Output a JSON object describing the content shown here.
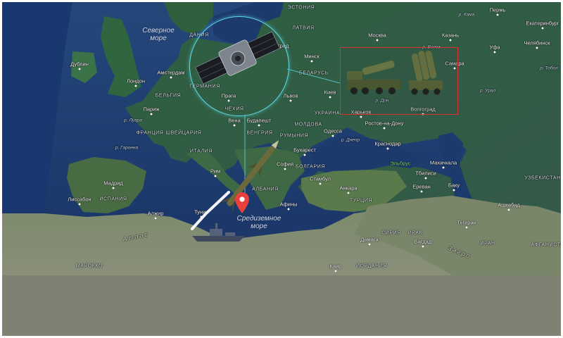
{
  "map": {
    "cities": [
      {
        "id": "dublin",
        "name": "Дублин"
      },
      {
        "id": "london",
        "name": "Лондон"
      },
      {
        "id": "amsterdam",
        "name": "Амстердам"
      },
      {
        "id": "paris",
        "name": "Париж"
      },
      {
        "id": "prague",
        "name": "Прага"
      },
      {
        "id": "vienna",
        "name": "Вена"
      },
      {
        "id": "budapest",
        "name": "Будапешт"
      },
      {
        "id": "madrid",
        "name": "Мадрид"
      },
      {
        "id": "lisbon",
        "name": "Лиссабон"
      },
      {
        "id": "rome",
        "name": "Рим"
      },
      {
        "id": "algiers",
        "name": "Алжир"
      },
      {
        "id": "tunis",
        "name": "Тунис"
      },
      {
        "id": "athens",
        "name": "Афины"
      },
      {
        "id": "sofia",
        "name": "София"
      },
      {
        "id": "bucharest",
        "name": "Бухарест"
      },
      {
        "id": "istanbul",
        "name": "Стамбул"
      },
      {
        "id": "ankara",
        "name": "Анкара"
      },
      {
        "id": "odessa",
        "name": "Одесса"
      },
      {
        "id": "kiev",
        "name": "Киев"
      },
      {
        "id": "lviv",
        "name": "Львов"
      },
      {
        "id": "minsk",
        "name": "Минск"
      },
      {
        "id": "kaliningrad",
        "name": "Калининград"
      },
      {
        "id": "moscow",
        "name": "Москва"
      },
      {
        "id": "kazan",
        "name": "Казань"
      },
      {
        "id": "samara",
        "name": "Самара"
      },
      {
        "id": "ufa",
        "name": "Уфа"
      },
      {
        "id": "perm",
        "name": "Пермь"
      },
      {
        "id": "yekaterinburg",
        "name": "Екатеринбург"
      },
      {
        "id": "chelyabinsk",
        "name": "Челябинск"
      },
      {
        "id": "kharkov",
        "name": "Харьков"
      },
      {
        "id": "volgograd",
        "name": "Волгоград"
      },
      {
        "id": "rostov",
        "name": "Ростов-на-Дону"
      },
      {
        "id": "krasnodar",
        "name": "Краснодар"
      },
      {
        "id": "tbilisi",
        "name": "Тбилиси"
      },
      {
        "id": "yerevan",
        "name": "Ереван"
      },
      {
        "id": "baku",
        "name": "Баку"
      },
      {
        "id": "makhachkala",
        "name": "Махачкала"
      },
      {
        "id": "ashgabat",
        "name": "Ашхабад"
      },
      {
        "id": "tehran",
        "name": "Тегеран"
      },
      {
        "id": "damascus",
        "name": "Дамаск"
      },
      {
        "id": "baghdad",
        "name": "Багдад"
      },
      {
        "id": "cairo",
        "name": "Каир"
      }
    ],
    "countries": [
      {
        "id": "estonia",
        "name": "ЭСТОНИЯ"
      },
      {
        "id": "latvia",
        "name": "ЛАТВИЯ"
      },
      {
        "id": "denmark",
        "name": "ДАНИЯ"
      },
      {
        "id": "belarus",
        "name": "БЕЛАРУСЬ"
      },
      {
        "id": "germany",
        "name": "ГЕРМАНИЯ"
      },
      {
        "id": "belgium",
        "name": "БЕЛЬГИЯ"
      },
      {
        "id": "czech",
        "name": "ЧЕХИЯ"
      },
      {
        "id": "ukraine",
        "name": "УКРАИНА"
      },
      {
        "id": "moldova",
        "name": "МОЛДОВА"
      },
      {
        "id": "hungary",
        "name": "ВЕНГРИЯ"
      },
      {
        "id": "romania",
        "name": "РУМЫНИЯ"
      },
      {
        "id": "switzerland",
        "name": "ШВЕЙЦАРИЯ"
      },
      {
        "id": "france",
        "name": "ФРАНЦИЯ"
      },
      {
        "id": "italy",
        "name": "ИТАЛИЯ"
      },
      {
        "id": "spain",
        "name": "ИСПАНИЯ"
      },
      {
        "id": "bulgaria",
        "name": "БОЛГАРИЯ"
      },
      {
        "id": "albania",
        "name": "АЛБАНИЯ"
      },
      {
        "id": "turkey",
        "name": "ТУРЦИЯ"
      },
      {
        "id": "syria",
        "name": "СИРИЯ"
      },
      {
        "id": "iraq",
        "name": "ИРАК"
      },
      {
        "id": "iran",
        "name": "ИРАН"
      },
      {
        "id": "uzbekistan",
        "name": "УЗБЕКИСТАН"
      },
      {
        "id": "afghanistan",
        "name": "АФГАНИСТАН"
      },
      {
        "id": "morocco",
        "name": "МАРОККО"
      },
      {
        "id": "jordan",
        "name": "ИОРДАНИЯ"
      }
    ],
    "seas": [
      {
        "id": "north-sea",
        "name": "Северное\nморе"
      },
      {
        "id": "mediterranean",
        "name": "Средиземное\nморе"
      }
    ],
    "mountains": [
      {
        "id": "atlas",
        "name": "Атлас"
      },
      {
        "id": "zagros",
        "name": "Загро"
      }
    ],
    "rivers": [
      {
        "id": "r-ural",
        "name": "р. Урал"
      },
      {
        "id": "r-volga",
        "name": "р. Волга"
      },
      {
        "id": "r-don",
        "name": "р. Дон"
      },
      {
        "id": "r-kama",
        "name": "р. Кама"
      },
      {
        "id": "r-tobol",
        "name": "р. Тобол"
      },
      {
        "id": "r-dnepr",
        "name": "р. Днепр"
      },
      {
        "id": "r-garonne",
        "name": "р. Гаронна"
      },
      {
        "id": "r-loire",
        "name": "р. Луара"
      }
    ],
    "peaks": [
      {
        "id": "elbrus",
        "name": "Эльбрус"
      }
    ]
  },
  "overlays": {
    "satellite": "satellite-icon",
    "missile": "missile-icon",
    "launchers": "missile-launcher-icon",
    "pin": "map-pin-icon",
    "ship": "warship-icon",
    "colors": {
      "circle": "#5fd9e6",
      "inset_border": "#e0302e",
      "pin": "#e8403a",
      "water": "#1b3a6b",
      "land": "#2f5a3a"
    }
  }
}
